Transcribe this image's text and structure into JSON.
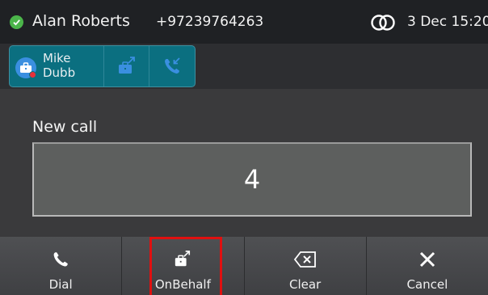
{
  "status": {
    "caller_name": "Alan Roberts",
    "caller_number": "+97239764263",
    "clock": "3 Dec 15:20",
    "icons": [
      "check-circle-icon",
      "linked-rings-icon"
    ]
  },
  "shortcuts": {
    "contact": {
      "name_line1": "Mike",
      "name_line2": "Dubb",
      "icon": "contact-briefcase-icon",
      "presence": "busy"
    },
    "buttons": [
      {
        "icon": "briefcase-transfer-icon"
      },
      {
        "icon": "phone-incoming-icon"
      }
    ]
  },
  "dialer": {
    "label": "New call",
    "value": "4"
  },
  "softkeys": [
    {
      "label": "Dial",
      "icon": "phone-icon"
    },
    {
      "label": "OnBehalf",
      "icon": "briefcase-transfer-icon",
      "highlighted": true
    },
    {
      "label": "Clear",
      "icon": "backspace-icon"
    },
    {
      "label": "Cancel",
      "icon": "close-icon"
    }
  ],
  "colors": {
    "status_bar": "#1f2124",
    "shortcut_accent": "#0b6f80",
    "presence_ok": "#4bb54a",
    "presence_busy": "#e8303a",
    "highlight": "#e01010"
  }
}
